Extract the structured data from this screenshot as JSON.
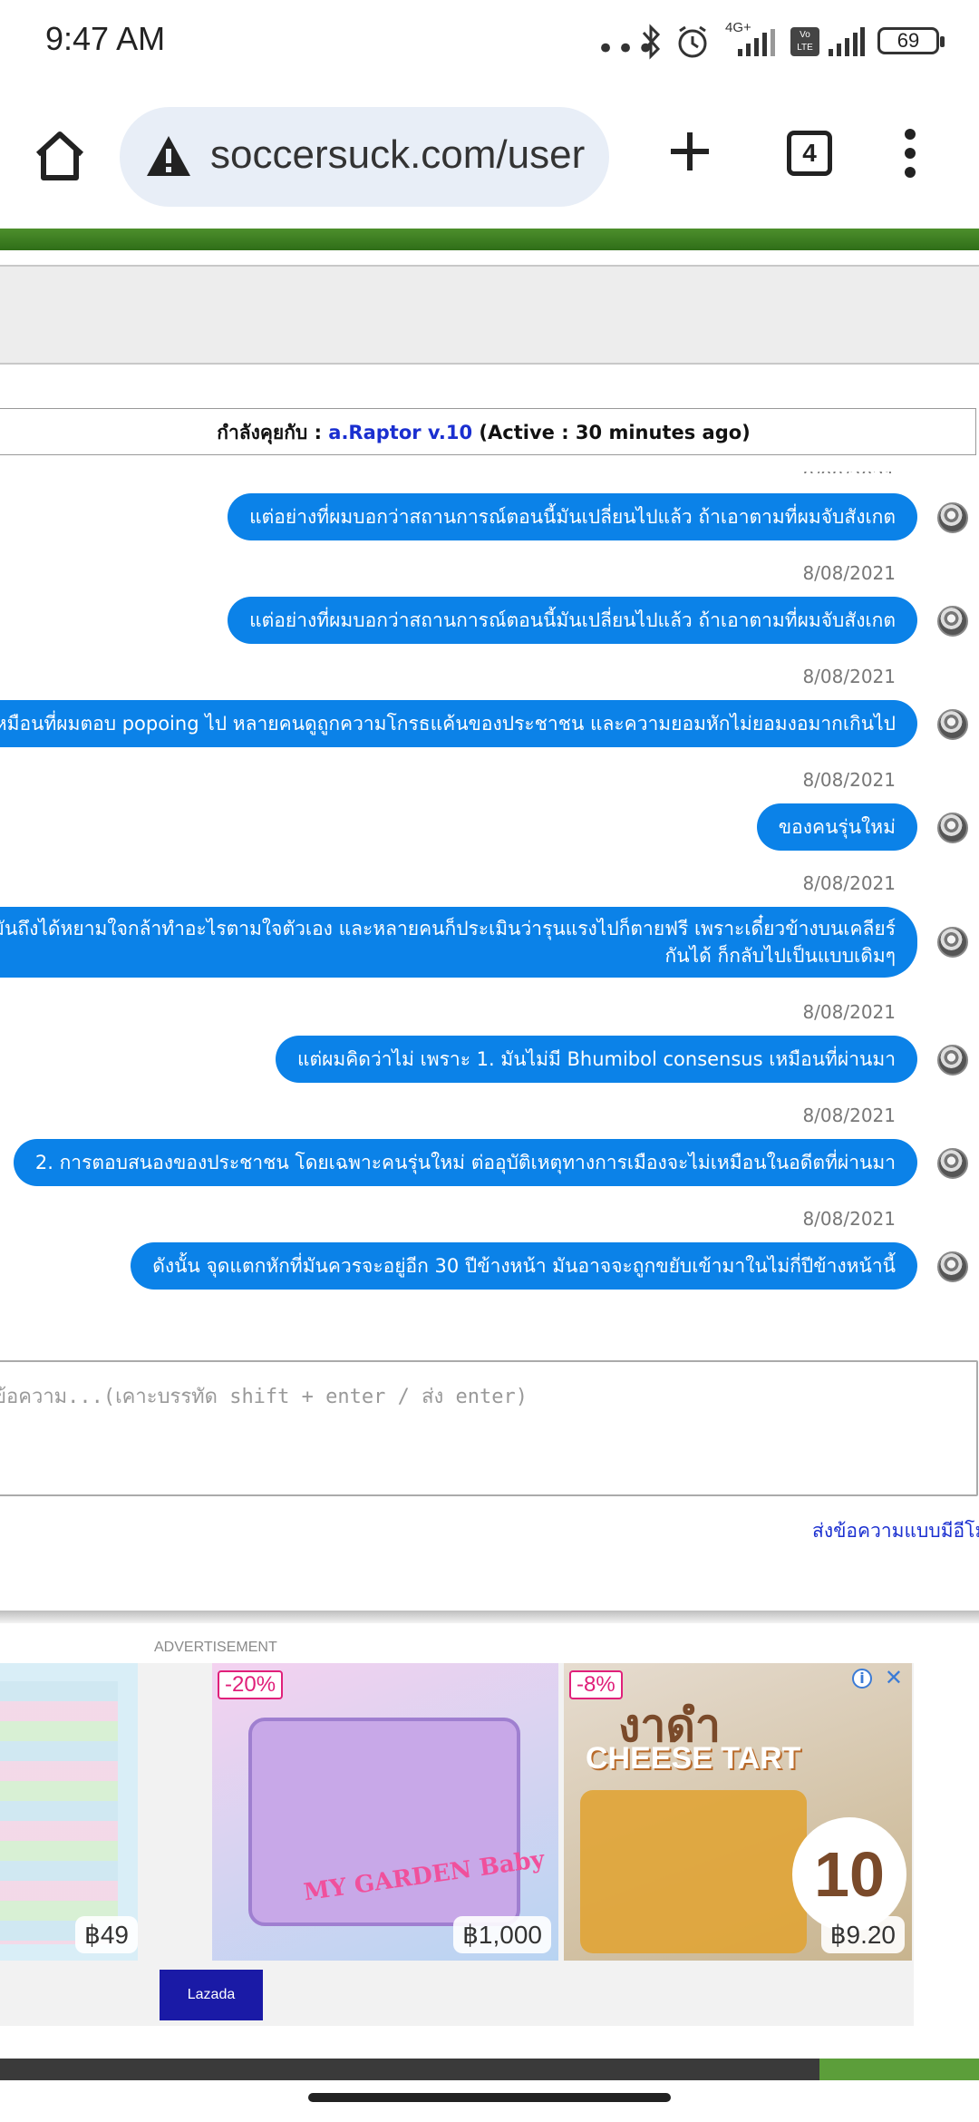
{
  "status_bar": {
    "time": "9:47 AM",
    "network_label": "4G+",
    "volte_label": "Vo LTE",
    "battery": "69"
  },
  "browser": {
    "url": "soccersuck.com/user",
    "tab_count": "4"
  },
  "chat": {
    "header_prefix": "กำลังคุยกับ : ",
    "username": "a.Raptor v.10",
    "header_suffix": " (Active : 30 minutes ago)",
    "messages": [
      {
        "text": "แต่อย่างที่ผมบอกว่าสถานการณ์ตอนนี้มันเปลี่ยนไปแล้ว ถ้าเอาตามที่ผมจับสังเกต",
        "date": "8/08/2021"
      },
      {
        "text": "แต่อย่างที่ผมบอกว่าสถานการณ์ตอนนี้มันเปลี่ยนไปแล้ว ถ้าเอาตามที่ผมจับสังเกต",
        "date": "8/08/2021"
      },
      {
        "text": "เหมือนที่ผมตอบ popoing ไป หลายคนดูถูกความโกรธแค้นของประชาชน และความยอมหักไม่ยอมงอมากเกินไป",
        "date": "8/08/2021"
      },
      {
        "text": "ของคนรุ่นใหม่",
        "date": "8/08/2021"
      },
      {
        "line1": "ขึ้นนำมันถึงได้หยามใจกล้าทำอะไรตามใจตัวเอง และหลายคนก็ประเมินว่ารุนแรงไปก็ตายฟรี เพราะเดี๋ยวข้างบนเคลียร์",
        "line2": "กันได้ ก็กลับไปเป็นแบบเดิมๆ",
        "date": "8/08/2021"
      },
      {
        "text": "แต่ผมคิดว่าไม่ เพราะ 1. มันไม่มี Bhumibol consensus เหมือนที่ผ่านมา",
        "date": "8/08/2021"
      },
      {
        "text": "2. การตอบสนองของประชาชน โดยเฉพาะคนรุ่นใหม่ ต่ออุบัติเหตุทางการเมืองจะไม่เหมือนในอดีตที่ผ่านมา",
        "date": "8/08/2021"
      },
      {
        "text": "ดังนั้น จุดแตกหักที่มันควรจะอยู่อีก 30 ปีข้างหน้า มันอาจจะถูกขยับเข้ามาในไม่กี่ปีข้างหน้านี้"
      }
    ],
    "input_placeholder": "ข้อความ...(เคาะบรรทัด shift + enter / ส่ง enter)",
    "emoji_link": "ส่งข้อความแบบมีอีโม"
  },
  "ad": {
    "label": "ADVERTISEMENT",
    "cards": [
      {
        "price": "฿49"
      },
      {
        "discount": "-20%",
        "price": "฿1,000",
        "logo_line1": "MY GARDEN",
        "logo_line2": "Baby"
      },
      {
        "discount": "-8%",
        "price": "฿9.20",
        "title_th": "งาดำ",
        "title_en": "CHEESE TART",
        "badge": "10"
      }
    ],
    "brand": "Lazada"
  }
}
